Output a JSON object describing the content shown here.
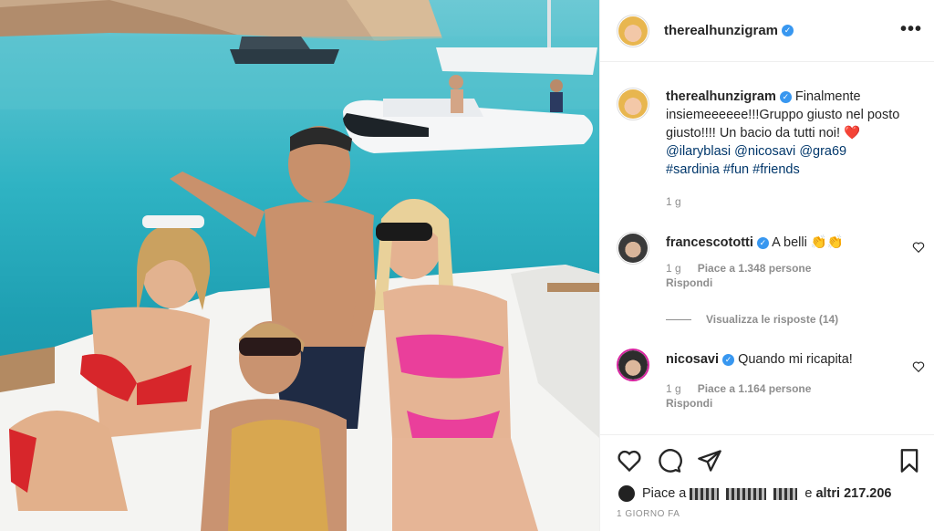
{
  "post": {
    "author": "therealhunzigram",
    "verified": true,
    "more_label": "•••"
  },
  "caption": {
    "author": "therealhunzigram",
    "text": "Finalmente insiemeeeeee!!!Gruppo giusto nel posto giusto!!!! Un bacio da tutti noi! ❤️",
    "mentions": [
      "@ilaryblasi",
      "@nicosavi",
      "@gra69"
    ],
    "hashtags": [
      "#sardinia",
      "#fun",
      "#friends"
    ],
    "time": "1 g"
  },
  "comments": [
    {
      "author": "francescototti",
      "verified": true,
      "text": "A belli 👏👏",
      "time": "1 g",
      "likes": "Piace a 1.348 persone",
      "reply": "Rispondi",
      "view_replies": "Visualizza le risposte (14)"
    },
    {
      "author": "nicosavi",
      "verified": true,
      "text": "Quando mi ricapita!",
      "time": "1 g",
      "likes": "Piace a 1.164 persone",
      "reply": "Rispondi"
    }
  ],
  "likes": {
    "prefix": "Piace a",
    "middle": "e",
    "others": "altri 217.206"
  },
  "posted": "1 GIORNO FA",
  "icons": {
    "like": "heart-icon",
    "comment": "comment-icon",
    "share": "share-icon",
    "save": "bookmark-icon",
    "more": "more-icon",
    "verified": "verified-badge-icon"
  },
  "colors": {
    "verified": "#3897f0",
    "link": "#00376b",
    "muted": "#8e8e8e",
    "sea": "#2fb3c3"
  }
}
